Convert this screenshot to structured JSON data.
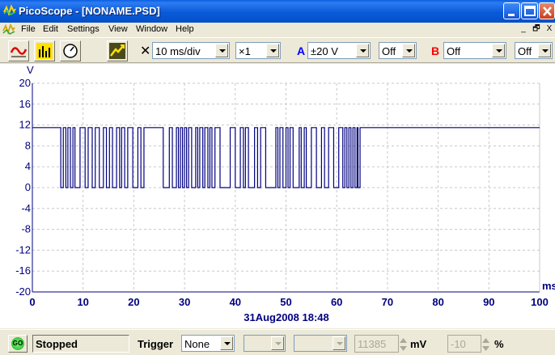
{
  "window": {
    "title": "PicoScope - [NONAME.PSD]",
    "title_bar_color": "#0A5AD8"
  },
  "menu": {
    "items": [
      "File",
      "Edit",
      "Settings",
      "View",
      "Window",
      "Help"
    ],
    "mdi_controls": [
      "_",
      "🗗",
      "X"
    ]
  },
  "toolbar": {
    "timebase": "10 ms/div",
    "multiplier": "×1",
    "channel_a_label": "A",
    "channel_a_range": "±20 V",
    "channel_a_coupling": "Off",
    "channel_b_label": "B",
    "channel_b_range": "Off",
    "channel_b_coupling": "Off",
    "channel_a_color": "#0000FF",
    "channel_b_color": "#FF0000",
    "buttons": [
      "scope-view-icon",
      "spectrum-view-icon",
      "meter-view-icon",
      "auto-setup-icon"
    ]
  },
  "graph": {
    "y_unit": "V",
    "x_unit": "ms",
    "timestamp": "31Aug2008  18:48",
    "trace_color": "#00007F"
  },
  "chart_data": {
    "type": "line",
    "title": "",
    "xlabel": "ms",
    "ylabel": "V",
    "xlim": [
      0,
      100
    ],
    "ylim": [
      -20,
      20
    ],
    "x_ticks": [
      "0",
      "10",
      "20",
      "30",
      "40",
      "50",
      "60",
      "70",
      "80",
      "90",
      "100"
    ],
    "y_ticks": [
      "20",
      "16",
      "12",
      "8",
      "4",
      "0",
      "-4",
      "-8",
      "-12",
      "-16",
      "-20"
    ],
    "grid": true,
    "series": [
      {
        "name": "",
        "high_level": 11.5,
        "low_level": 0,
        "idle_before_ms": [
          0,
          5.6
        ],
        "idle_after_ms": [
          64.6,
          100
        ],
        "pulses_low_ms": [
          [
            5.6,
            6.1
          ],
          [
            6.6,
            7.0
          ],
          [
            7.5,
            8.0
          ],
          [
            8.4,
            9.4
          ],
          [
            10.4,
            11.0
          ],
          [
            11.8,
            12.4
          ],
          [
            13.2,
            14.0
          ],
          [
            14.6,
            15.2
          ],
          [
            15.8,
            16.6
          ],
          [
            17.2,
            17.6
          ],
          [
            18.2,
            18.8
          ],
          [
            19.8,
            20.8
          ],
          [
            21.4,
            22.0
          ],
          [
            25.8,
            27.0
          ],
          [
            27.6,
            28.4
          ],
          [
            28.8,
            29.2
          ],
          [
            29.6,
            30.0
          ],
          [
            30.4,
            30.8
          ],
          [
            31.4,
            32.2
          ],
          [
            32.6,
            33.0
          ],
          [
            33.6,
            34.0
          ],
          [
            34.6,
            35.0
          ],
          [
            35.4,
            36.0
          ],
          [
            37.0,
            39.0
          ],
          [
            40.0,
            41.0
          ],
          [
            41.6,
            42.0
          ],
          [
            42.6,
            43.8
          ],
          [
            44.4,
            45.0
          ],
          [
            46.0,
            48.0
          ],
          [
            48.4,
            48.8
          ],
          [
            49.4,
            50.0
          ],
          [
            50.4,
            50.8
          ],
          [
            51.4,
            52.6
          ],
          [
            53.0,
            53.6
          ],
          [
            54.0,
            55.0
          ],
          [
            56.0,
            57.0
          ],
          [
            57.6,
            58.4
          ],
          [
            59.4,
            60.4
          ],
          [
            61.2,
            61.6
          ],
          [
            62.0,
            62.4
          ],
          [
            62.8,
            63.2
          ],
          [
            63.6,
            64.0
          ],
          [
            64.2,
            64.6
          ]
        ]
      }
    ]
  },
  "status": {
    "go_label": "GO",
    "state": "Stopped",
    "trigger_label": "Trigger",
    "trigger_mode": "None",
    "trigger_channel": "",
    "trigger_direction": "",
    "trigger_level": "11385",
    "trigger_level_unit": "mV",
    "pre_trigger": "-10",
    "pre_trigger_unit": "%"
  }
}
